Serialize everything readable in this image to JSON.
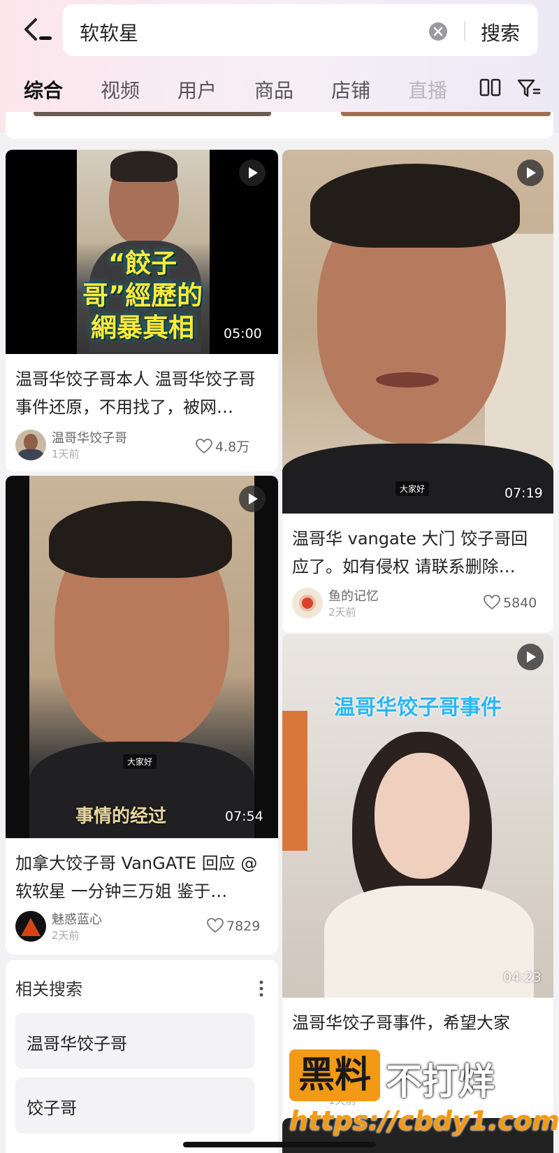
{
  "search": {
    "query": "软软星",
    "submit_label": "搜索"
  },
  "tabs": [
    "综合",
    "视频",
    "用户",
    "商品",
    "店铺",
    "直播"
  ],
  "cards": [
    {
      "overlay_title": "“餃子哥”經歷的網暴真相",
      "duration": "05:00",
      "title": "温哥华饺子哥本人 温哥华饺子哥事件还原，不用找了，被网…",
      "author": "温哥华饺子哥",
      "time": "1天前",
      "likes": "4.8万"
    },
    {
      "subtitle": "大家好",
      "duration": "07:19",
      "title": "温哥华 vangate 大门 饺子哥回应了。如有侵权 请联系删除…",
      "author": "鱼的记忆",
      "time": "2天前",
      "likes": "5840"
    },
    {
      "subtitle": "大家好",
      "caption": "事情的经过",
      "duration": "07:54",
      "title": "加拿大饺子哥 VanGATE 回应 @软软星 一分钟三万姐 鉴于…",
      "author": "魅惑蓝心",
      "time": "2天前",
      "likes": "7829"
    },
    {
      "overlay_title": "温哥华饺子哥事件",
      "duration": "04:23",
      "title": "温哥华饺子哥事件，希望大家",
      "time": "1天前"
    }
  ],
  "related": {
    "heading": "相关搜索",
    "items": [
      "温哥华饺子哥",
      "饺子哥"
    ]
  },
  "watermark": {
    "badge": "黑料",
    "text": "不打烊",
    "url": "https://cbdy1.com"
  },
  "colors": {
    "accent": "#f29a16",
    "header_pink": "#fbe6ec"
  }
}
